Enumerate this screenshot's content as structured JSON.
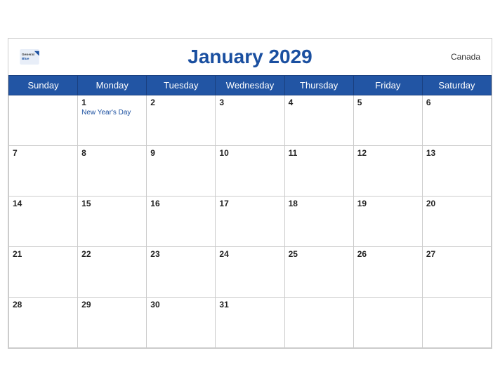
{
  "header": {
    "title": "January 2029",
    "country": "Canada",
    "logo": {
      "general": "General",
      "blue": "Blue"
    }
  },
  "weekdays": [
    "Sunday",
    "Monday",
    "Tuesday",
    "Wednesday",
    "Thursday",
    "Friday",
    "Saturday"
  ],
  "weeks": [
    [
      {
        "day": "",
        "empty": true
      },
      {
        "day": "1",
        "holiday": "New Year's Day"
      },
      {
        "day": "2"
      },
      {
        "day": "3"
      },
      {
        "day": "4"
      },
      {
        "day": "5"
      },
      {
        "day": "6"
      }
    ],
    [
      {
        "day": "7"
      },
      {
        "day": "8"
      },
      {
        "day": "9"
      },
      {
        "day": "10"
      },
      {
        "day": "11"
      },
      {
        "day": "12"
      },
      {
        "day": "13"
      }
    ],
    [
      {
        "day": "14"
      },
      {
        "day": "15"
      },
      {
        "day": "16"
      },
      {
        "day": "17"
      },
      {
        "day": "18"
      },
      {
        "day": "19"
      },
      {
        "day": "20"
      }
    ],
    [
      {
        "day": "21"
      },
      {
        "day": "22"
      },
      {
        "day": "23"
      },
      {
        "day": "24"
      },
      {
        "day": "25"
      },
      {
        "day": "26"
      },
      {
        "day": "27"
      }
    ],
    [
      {
        "day": "28"
      },
      {
        "day": "29"
      },
      {
        "day": "30"
      },
      {
        "day": "31"
      },
      {
        "day": ""
      },
      {
        "day": ""
      },
      {
        "day": ""
      }
    ]
  ]
}
